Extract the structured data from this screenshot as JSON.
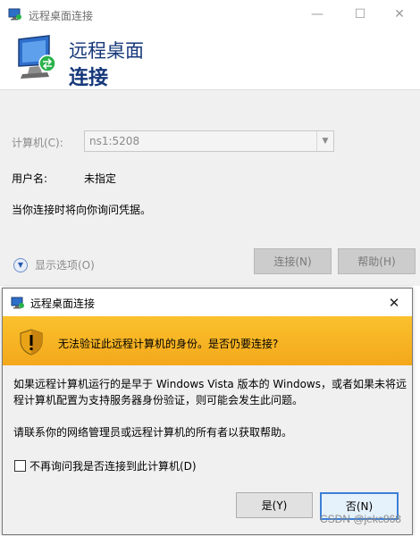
{
  "background_window": {
    "title": "远程桌面连接",
    "banner_line1": "远程桌面",
    "banner_line2": "连接",
    "computer_label": "计算机(C):",
    "computer_value": "ns1:5208",
    "username_label": "用户名:",
    "username_value": "未指定",
    "info_text": "当你连接时将向你询问凭据。",
    "show_options": "显示选项(O)",
    "connect_button": "连接(N)",
    "help_button": "帮助(H)",
    "minimize_glyph": "—",
    "maximize_glyph": "☐",
    "close_glyph": "✕"
  },
  "dialog": {
    "title": "远程桌面连接",
    "close_glyph": "✕",
    "warning_text": "无法验证此远程计算机的身份。是否仍要连接?",
    "message_1": "如果远程计算机运行的是早于 Windows Vista 版本的 Windows，或者如果未将远程计算机配置为支持服务器身份验证，则可能会发生此问题。",
    "message_2": "请联系你的网络管理员或远程计算机的所有者以获取帮助。",
    "checkbox_label": "不再询问我是否连接到此计算机(D)",
    "checkbox_checked": false,
    "yes_button": "是(Y)",
    "no_button": "否(N)"
  },
  "watermark": "CSDN @jekc868",
  "colors": {
    "banner_text": "#16387a",
    "warning_bar": "#f6b120",
    "primary_border": "#3c7fd6"
  },
  "icons": [
    "rdp-icon",
    "monitor-icon",
    "shield-warning-icon",
    "chevron-down-icon",
    "close-icon"
  ]
}
